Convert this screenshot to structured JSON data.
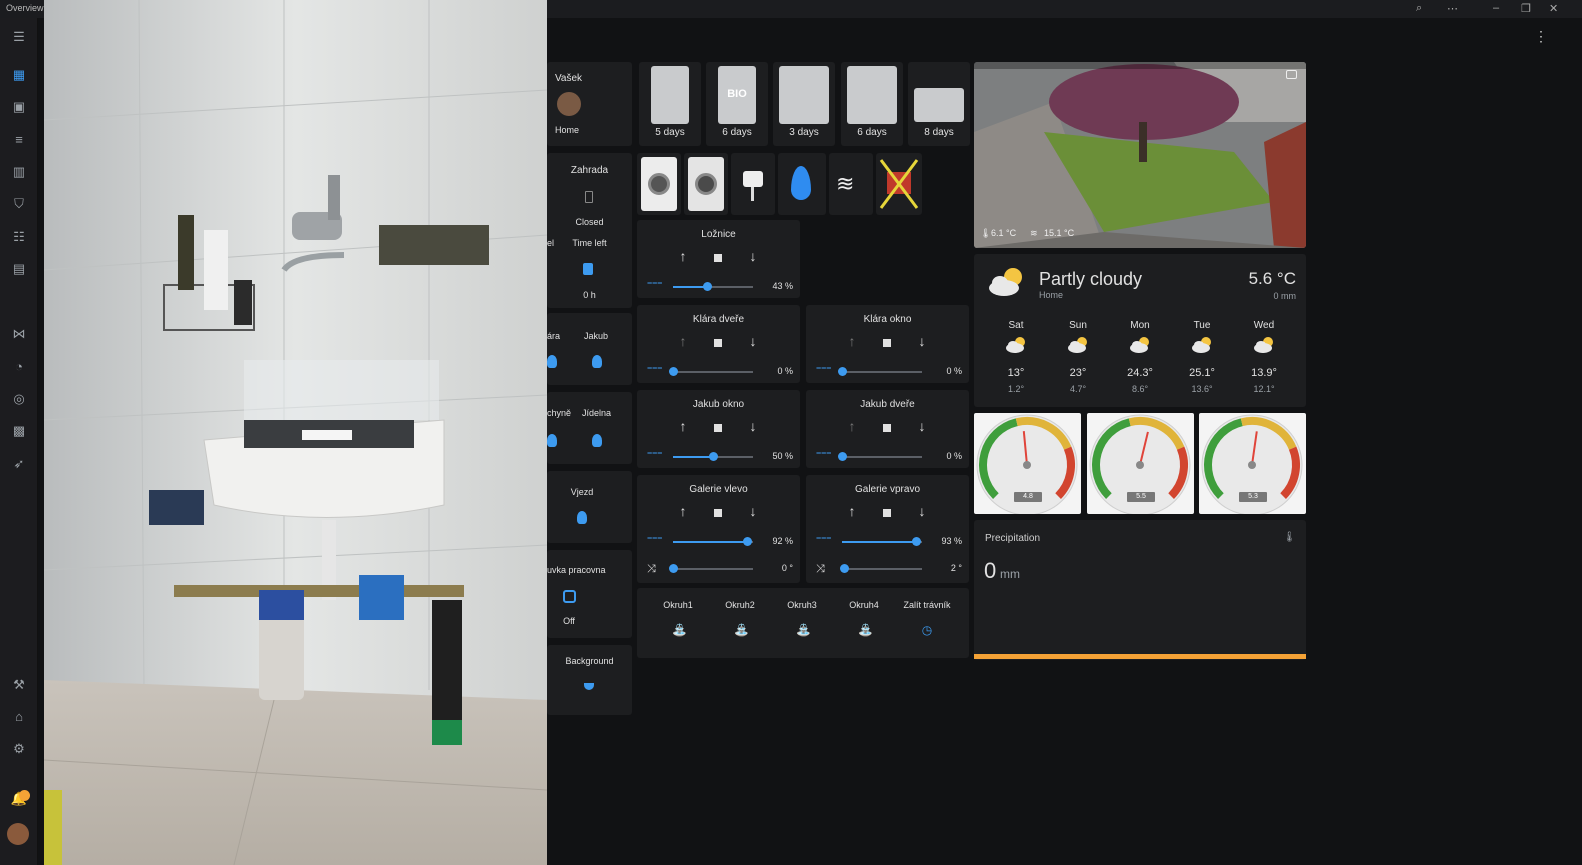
{
  "window": {
    "title": "Overview - Home Assistant"
  },
  "person": {
    "name": "Vašek",
    "state": "Home"
  },
  "bins": [
    {
      "label": "5 days",
      "badge": ""
    },
    {
      "label": "6 days",
      "badge": "BIO"
    },
    {
      "label": "3 days",
      "badge": ""
    },
    {
      "label": "6 days",
      "badge": ""
    },
    {
      "label": "8 days",
      "badge": ""
    }
  ],
  "garden": {
    "title": "Zahrada",
    "state": "Closed"
  },
  "timeleft": {
    "title": "Time left",
    "cut": "el",
    "value": "0 h"
  },
  "lights1": {
    "a": "ára",
    "b": "Jakub"
  },
  "lights2": {
    "a": "chyně",
    "b": "Jídelna"
  },
  "vjezd": {
    "label": "Vjezd"
  },
  "socket": {
    "label": "uvka pracovna",
    "state": "Off"
  },
  "background": {
    "label": "Background"
  },
  "covers": {
    "loznice": {
      "name": "Ložnice",
      "pos": "43 %",
      "value": 43
    },
    "klara_dvere": {
      "name": "Klára dveře",
      "pos": "0 %",
      "value": 0
    },
    "klara_okno": {
      "name": "Klára okno",
      "pos": "0 %",
      "value": 0
    },
    "jakub_okno": {
      "name": "Jakub okno",
      "pos": "50 %",
      "value": 50
    },
    "jakub_dvere": {
      "name": "Jakub dveře",
      "pos": "0 %",
      "value": 0
    },
    "galerie_vlevo": {
      "name": "Galerie vlevo",
      "pos": "92 %",
      "value": 92,
      "tilt": "0 °",
      "tiltValue": 0
    },
    "galerie_vpravo": {
      "name": "Galerie vpravo",
      "pos": "93 %",
      "value": 93,
      "tilt": "2 °",
      "tiltValue": 2
    }
  },
  "irrigation": [
    "Okruh1",
    "Okruh2",
    "Okruh3",
    "Okruh4",
    "Zalít trávník"
  ],
  "camera": {
    "temp1": "6.1 °C",
    "temp2": "15.1 °C"
  },
  "weather": {
    "condition": "Partly cloudy",
    "location": "Home",
    "temp": "5.6 °C",
    "precip": "0 mm",
    "forecast": [
      {
        "day": "Sat",
        "hi": "13°",
        "lo": "1.2°"
      },
      {
        "day": "Sun",
        "hi": "23°",
        "lo": "4.7°"
      },
      {
        "day": "Mon",
        "hi": "24.3°",
        "lo": "8.6°"
      },
      {
        "day": "Tue",
        "hi": "25.1°",
        "lo": "13.6°"
      },
      {
        "day": "Wed",
        "hi": "13.9°",
        "lo": "12.1°"
      }
    ]
  },
  "gauges": [
    {
      "value": "4.8",
      "level": 0.48
    },
    {
      "value": "5.5",
      "level": 0.55
    },
    {
      "value": "5.3",
      "level": 0.53
    }
  ],
  "precipitation": {
    "title": "Precipitation",
    "value": "0",
    "unit": "mm"
  },
  "colors": {
    "accent": "#3d9bf0",
    "card": "#1d1e20",
    "bg": "#111214",
    "orange": "#f4a236"
  }
}
